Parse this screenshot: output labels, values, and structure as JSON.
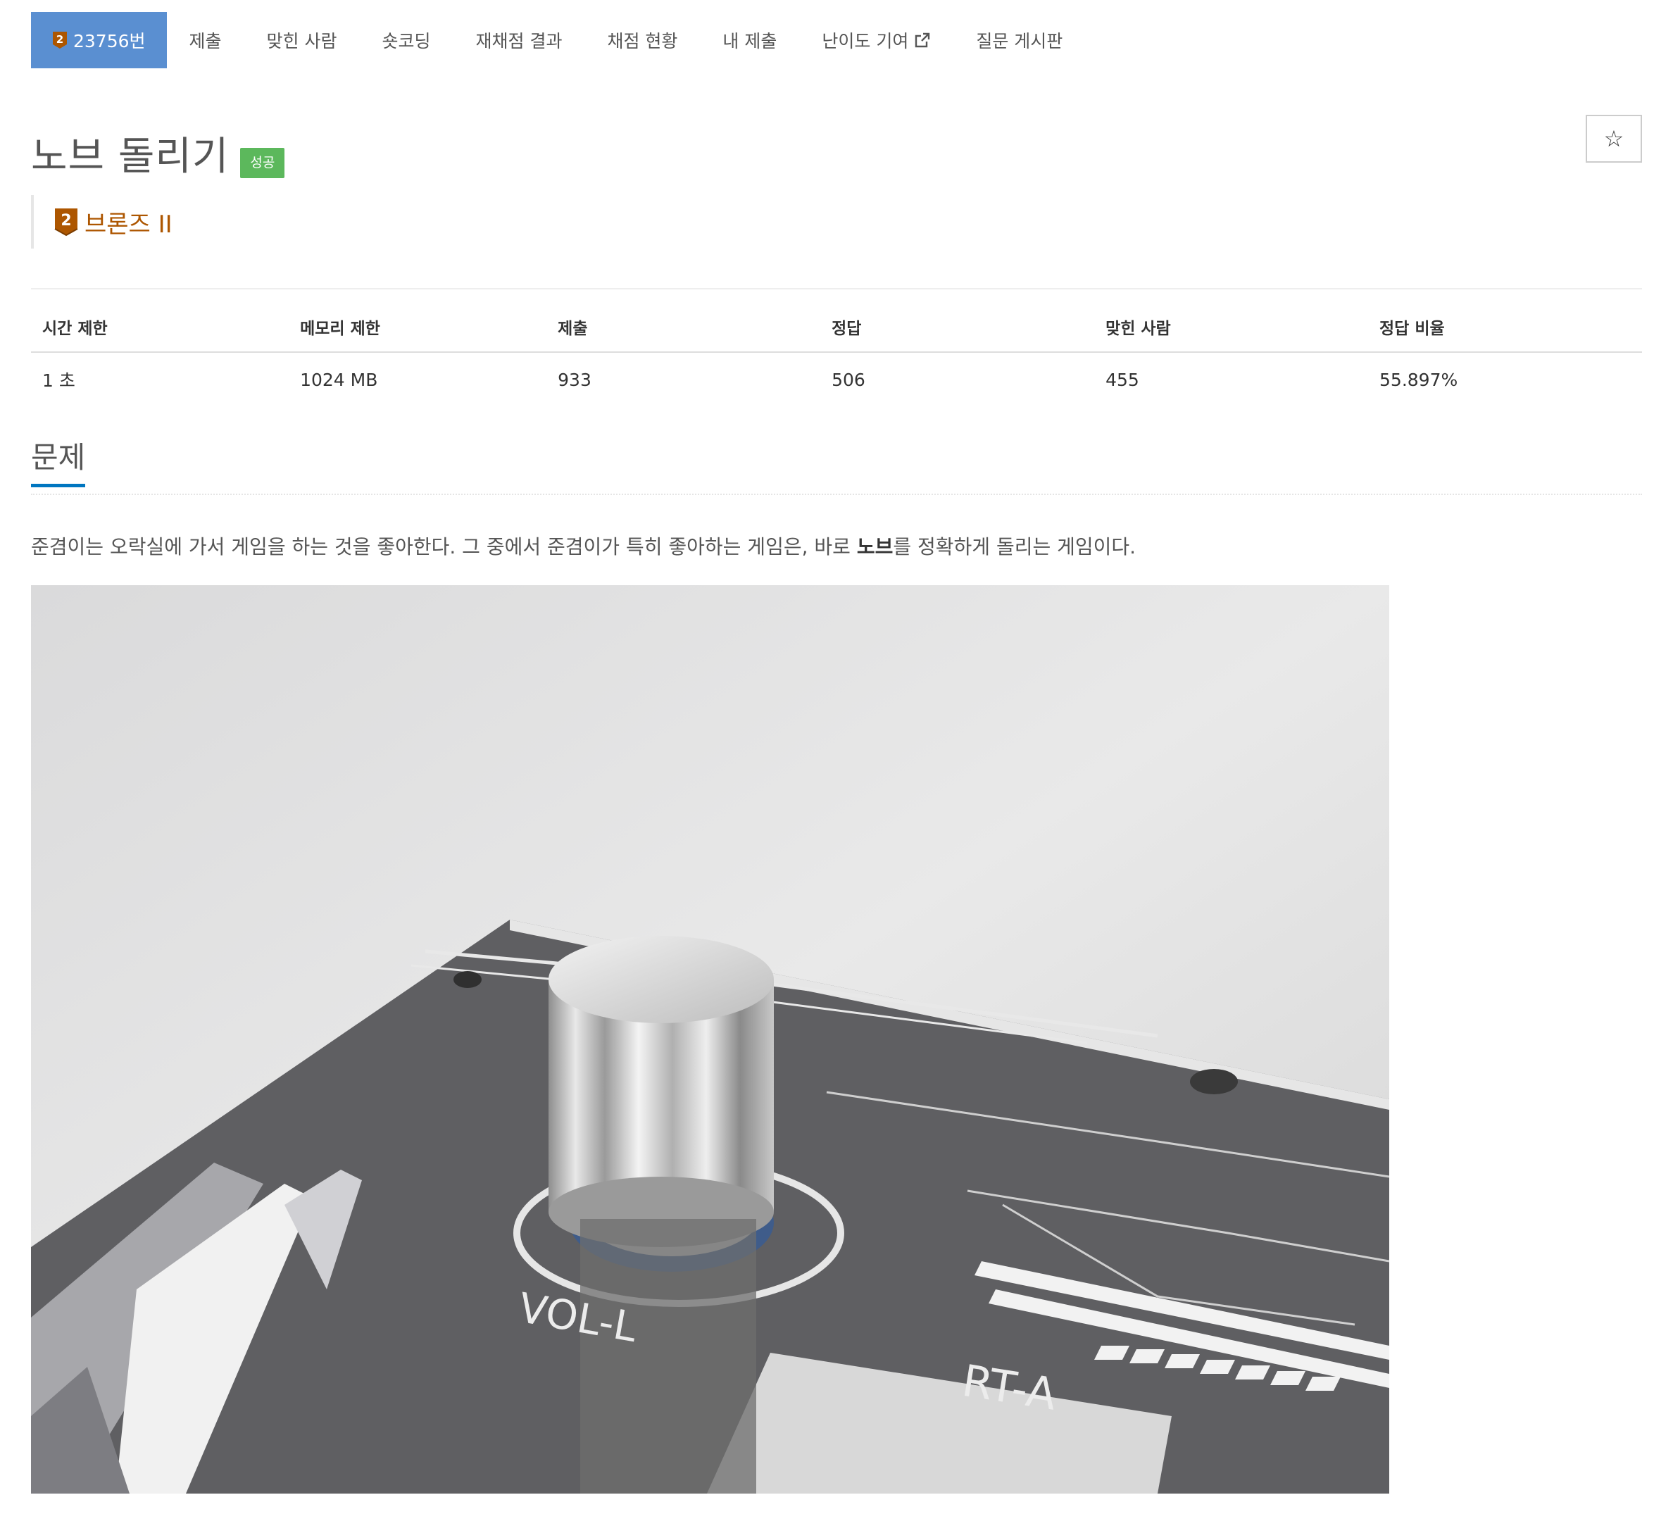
{
  "tabs": {
    "problem_number": "23756번",
    "items": [
      "제출",
      "맞힌 사람",
      "숏코딩",
      "재채점 결과",
      "채점 현황",
      "내 제출",
      "난이도 기여",
      "질문 게시판"
    ]
  },
  "problem": {
    "title": "노브 돌리기",
    "status_badge": "성공",
    "tier_label": "브론즈 II",
    "tier_number": "2"
  },
  "info_table": {
    "headers": [
      "시간 제한",
      "메모리 제한",
      "제출",
      "정답",
      "맞힌 사람",
      "정답 비율"
    ],
    "values": [
      "1 초",
      "1024 MB",
      "933",
      "506",
      "455",
      "55.897%"
    ]
  },
  "section": {
    "title": "문제"
  },
  "description": {
    "text_before": "준겸이는 오락실에 가서 게임을 하는 것을 좋아한다. 그 중에서 준겸이가 특히 좋아하는 게임은, 바로 ",
    "bold": "노브",
    "text_after": "를 정확하게 돌리는 게임이다."
  },
  "photo_labels": {
    "left": "VOL-L",
    "right": "RT-A"
  },
  "colors": {
    "active_tab": "#5a8fd1",
    "success_badge": "#5cb85c",
    "bronze": "#ad5600",
    "section_underline": "#0076c0"
  },
  "icons": [
    "bronze-tier-icon",
    "external-link-icon",
    "star-icon"
  ]
}
